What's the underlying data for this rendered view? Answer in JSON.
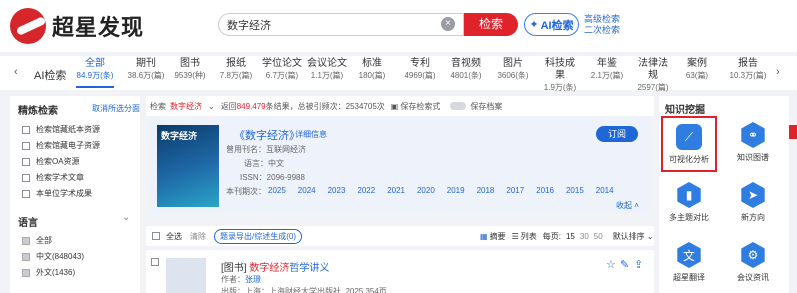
{
  "header": {
    "logo_text": "超星发现",
    "search_value": "数字经济",
    "search_button": "检索",
    "ai_button": "AI检索",
    "advanced": "高级检索",
    "secondary": "二次检索"
  },
  "catbar": {
    "ai_tab": "AI检索",
    "cats": [
      {
        "name": "全部",
        "count": "84.9万(条)"
      },
      {
        "name": "期刊",
        "count": "38.6万(篇)"
      },
      {
        "name": "图书",
        "count": "9539(种)"
      },
      {
        "name": "报纸",
        "count": "7.8万(篇)"
      },
      {
        "name": "学位论文",
        "count": "6.7万(篇)"
      },
      {
        "name": "会议论文",
        "count": "1.1万(篇)"
      },
      {
        "name": "标准",
        "count": "180(篇)"
      },
      {
        "name": "专利",
        "count": "4969(篇)"
      },
      {
        "name": "音视频",
        "count": "4801(条)"
      },
      {
        "name": "图片",
        "count": "3606(条)"
      },
      {
        "name": "科技成果",
        "count": "1.9万(条)"
      },
      {
        "name": "年鉴",
        "count": "2.1万(篇)"
      },
      {
        "name": "法律法规",
        "count": "2597(篇)"
      },
      {
        "name": "案例",
        "count": "63(篇)"
      },
      {
        "name": "报告",
        "count": "10.3万(篇)"
      }
    ]
  },
  "sidebar": {
    "title": "精炼检索",
    "clear": "取消所选分面",
    "filters": [
      "检索馆藏纸本资源",
      "检索馆藏电子资源",
      "检索OA资源",
      "检索学术文章",
      "本单位学术成果"
    ],
    "lang_title": "语言",
    "langs": [
      "全部",
      "中文(848043)",
      "外文(1436)"
    ]
  },
  "stats": {
    "prefix": "检索",
    "keyword": "数字经济",
    "returned_label": "返回",
    "returned": "849,479",
    "text": "条结果，总被引频次：2534705次",
    "save": "保存检索式",
    "archive": "保存档案"
  },
  "journal": {
    "cover_title": "数字经济",
    "title": "《数字经济》",
    "detail_link": "详细信息",
    "subscribe": "订阅",
    "former_label": "曾用刊名：",
    "former": "互联网经济",
    "lang_label": "语言：",
    "lang": "中文",
    "issn_label": "ISSN：",
    "issn": "2096-9988",
    "years_label": "本刊期次：",
    "years": [
      "2025",
      "2024",
      "2023",
      "2022",
      "2021",
      "2020",
      "2019",
      "2018",
      "2017",
      "2016",
      "2015",
      "2014"
    ],
    "collapse": "收起"
  },
  "toolbar": {
    "select_all": "全选",
    "clear": "清除",
    "export": "题录导出/综述生成(0)",
    "abstract": "摘要",
    "list": "列表",
    "per_page_label": "每页:",
    "per_page": [
      "15",
      "30",
      "50"
    ],
    "sort": "默认排序"
  },
  "result": {
    "type": "[图书]",
    "title_highlight": "数字经济",
    "title_rest": "哲学讲义",
    "author_label": "作者：",
    "author": "张璟",
    "publisher_partial": "出版：上海：上海财经大学出版社, 2025.354页"
  },
  "right_panel": {
    "title": "知识挖掘",
    "tools": [
      {
        "label": "可视化分析",
        "icon": "chart-icon"
      },
      {
        "label": "知识图谱",
        "icon": "graph-icon"
      },
      {
        "label": "多主题对比",
        "icon": "bar-compare-icon"
      },
      {
        "label": "新方向",
        "icon": "compass-icon"
      },
      {
        "label": "超星翻译",
        "icon": "translate-icon"
      },
      {
        "label": "会议资讯",
        "icon": "gear-icon"
      }
    ]
  },
  "colors": {
    "accent": "#1f66d6",
    "brand": "#e0232a"
  }
}
